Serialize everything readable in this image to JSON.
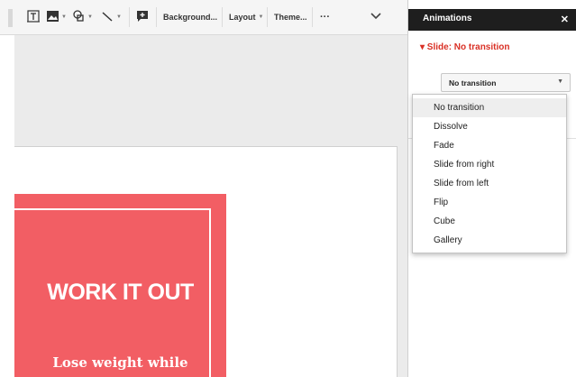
{
  "toolbar": {
    "textbox_icon": "text-box-icon",
    "image_icon": "image-icon",
    "shape_icon": "shape-icon",
    "line_icon": "line-icon",
    "comment_icon": "add-comment-icon",
    "background_label": "Background...",
    "layout_label": "Layout",
    "theme_label": "Theme...",
    "more_label": "···",
    "collapse_icon": "chevron-down-icon"
  },
  "slide": {
    "title": "WORK IT OUT",
    "subtitle": "Lose weight while",
    "card_color": "#f25e64"
  },
  "panel": {
    "title": "Animations",
    "close_label": "✕",
    "slide_heading": "▾ Slide: No transition",
    "select_value": "No transition",
    "accent_color": "#d93025"
  },
  "menu": {
    "options": [
      "No transition",
      "Dissolve",
      "Fade",
      "Slide from right",
      "Slide from left",
      "Flip",
      "Cube",
      "Gallery"
    ],
    "selected": "No transition"
  }
}
